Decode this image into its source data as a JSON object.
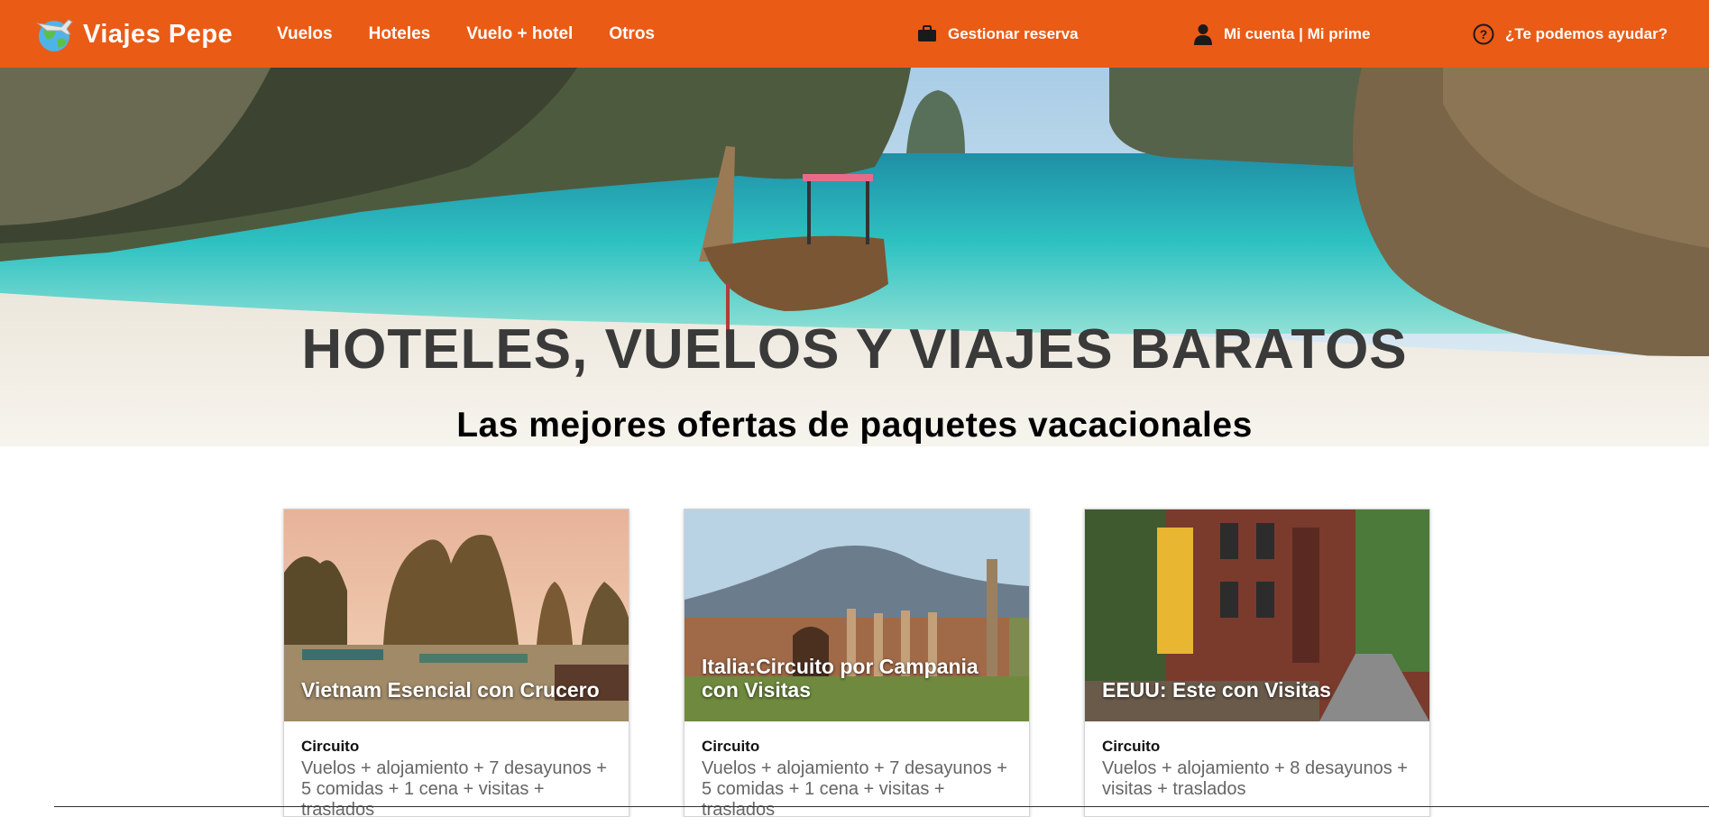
{
  "header": {
    "brand": "Viajes Pepe",
    "nav": [
      "Vuelos",
      "Hoteles",
      "Vuelo + hotel",
      "Otros"
    ],
    "manage_booking": "Gestionar reserva",
    "account": "Mi cuenta | Mi prime",
    "help": "¿Te podemos ayudar?",
    "icons": [
      "globe-plane-logo",
      "briefcase-icon",
      "user-icon",
      "help-circle-icon"
    ],
    "colors": {
      "bar": "#ea5b16",
      "text": "#ffffff"
    }
  },
  "hero": {
    "title": "HOTELES, VUELOS Y VIAJES BARATOS",
    "subtitle": "Las mejores ofertas de paquetes vacacionales"
  },
  "cards": [
    {
      "caption": "Vietnam Esencial con Crucero",
      "type": "Circuito",
      "description": "Vuelos + alojamiento + 7 desayunos + 5 comidas + 1 cena + visitas + traslados"
    },
    {
      "caption": "Italia:Circuito por Campania con Visitas",
      "type": "Circuito",
      "description": "Vuelos + alojamiento + 7 desayunos + 5 comidas + 1 cena + visitas + traslados"
    },
    {
      "caption": "EEUU: Este con Visitas",
      "type": "Circuito",
      "description": "Vuelos + alojamiento + 8 desayunos + visitas + traslados"
    }
  ]
}
